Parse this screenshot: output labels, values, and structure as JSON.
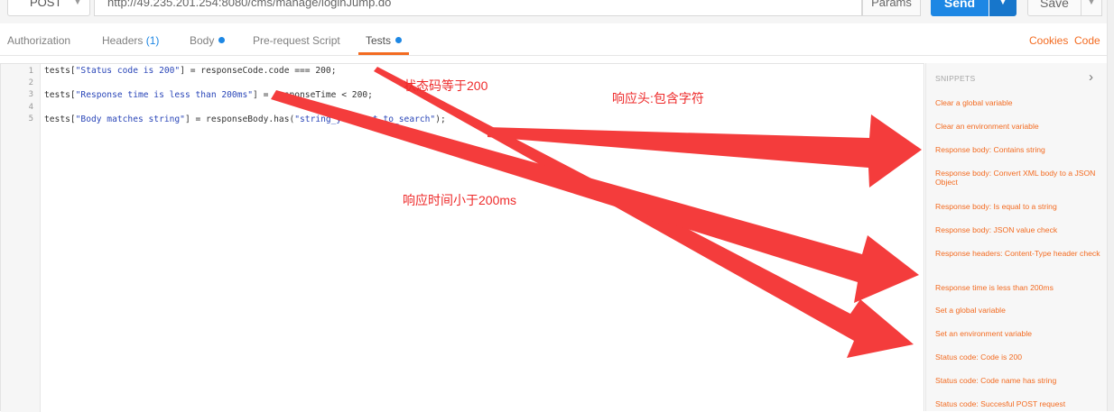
{
  "request": {
    "method": "POST",
    "url": "http://49.235.201.254:8080/cms/manage/loginJump.do",
    "params_label": "Params",
    "send_label": "Send",
    "save_label": "Save"
  },
  "tabs": {
    "authorization": "Authorization",
    "headers": "Headers",
    "headers_count": "(1)",
    "body": "Body",
    "prerequest": "Pre-request Script",
    "tests": "Tests",
    "cookies": "Cookies",
    "code": "Code"
  },
  "editor": {
    "line_numbers": [
      "1",
      "2",
      "3",
      "4",
      "5"
    ],
    "line1": {
      "pre": "tests[",
      "str": "\"Status code is 200\"",
      "post": "] = responseCode.code === 200;"
    },
    "line3": {
      "pre": "tests[",
      "str": "\"Response time is less than 200ms\"",
      "post": "] = responseTime < 200;"
    },
    "line5": {
      "pre": "tests[",
      "str": "\"Body matches string\"",
      "mid": "] = responseBody.has(",
      "str2": "\"string_you_want_to_search\"",
      "post": ");"
    }
  },
  "snippets": {
    "header": "SNIPPETS",
    "items": [
      "Clear a global variable",
      "Clear an environment variable",
      "Response body: Contains string",
      "Response body: Convert XML body to a JSON Object",
      "Response body: Is equal to a string",
      "Response body: JSON value check",
      "Response headers: Content-Type header check",
      "Response time is less than 200ms",
      "Set a global variable",
      "Set an environment variable",
      "Status code: Code is 200",
      "Status code: Code name has string",
      "Status code: Succesful POST request"
    ]
  },
  "annotations": {
    "status_code": "状态码等于200",
    "response_header": "响应头:包含字符",
    "response_time": "响应时间小于200ms"
  },
  "colors": {
    "accent_orange": "#f36b21",
    "send_blue": "#1d87e4",
    "annotation_red": "#ee2a2a"
  }
}
